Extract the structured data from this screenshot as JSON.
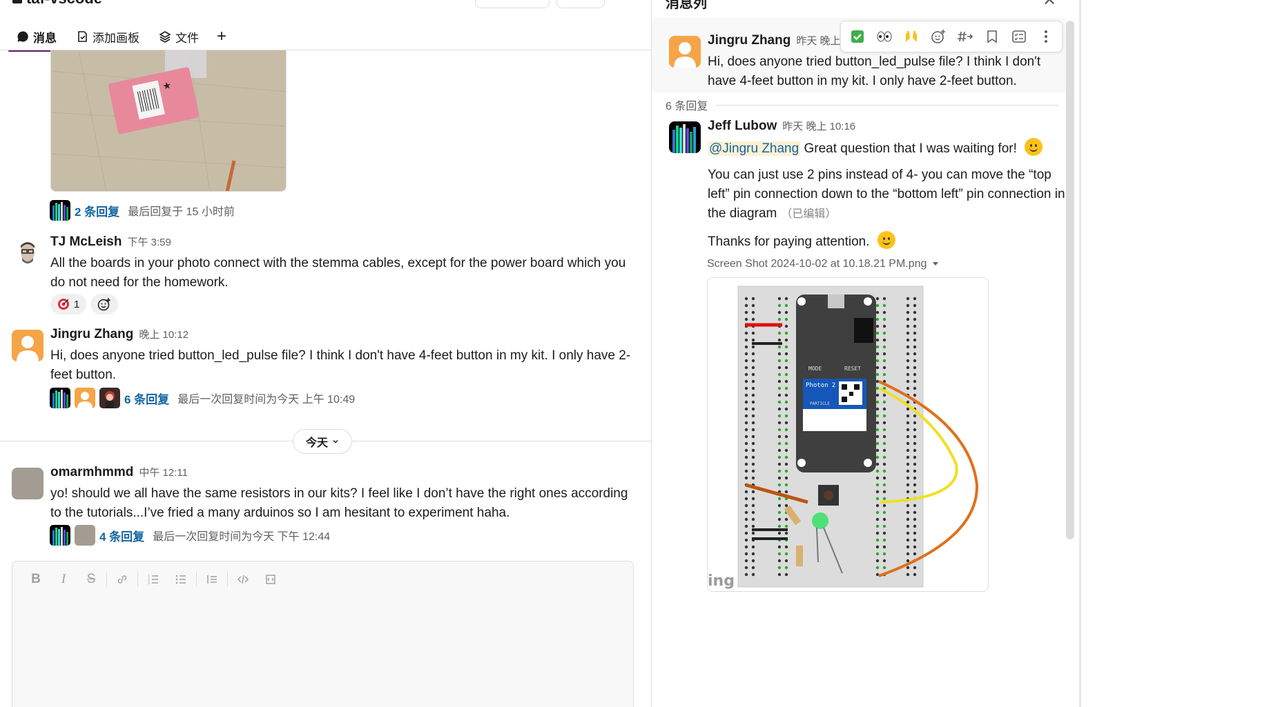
{
  "channel": {
    "title": "taf-vscode"
  },
  "tabs": [
    {
      "label": "消息",
      "icon": "message-icon",
      "active": true
    },
    {
      "label": "添加画板",
      "icon": "canvas-icon",
      "active": false
    },
    {
      "label": "文件",
      "icon": "files-icon",
      "active": false
    }
  ],
  "messages": {
    "first_thread": {
      "count_label": "2 条回复",
      "meta": "最后回复于 15 小时前"
    },
    "tj": {
      "name": "TJ McLeish",
      "time": "下午 3:59",
      "body": "All the boards in your photo connect with the stemma cables, except for the power board which you do not need for the homework.",
      "reaction_count": "1"
    },
    "jingru": {
      "name": "Jingru Zhang",
      "time": "晚上 10:12",
      "body": "Hi, does anyone tried button_led_pulse file? I think I don't have 4-feet button in my kit. I only have 2-feet button.",
      "thread": {
        "count_label": "6 条回复",
        "meta": "最后一次回复时间为今天 上午 10:49"
      }
    },
    "day_divider": "今天",
    "omar": {
      "name": "omarmhmmd",
      "time": "中午 12:11",
      "body": "yo! should we all have the same resistors in our kits? I feel like I don’t have the right ones according to the tutorials...I’ve fried a many arduinos so I am hesitant to experiment haha.",
      "thread": {
        "count_label": "4 条回复",
        "meta": "最后一次回复时间为今天 下午 12:44"
      }
    }
  },
  "composer": {
    "tools": [
      "B",
      "I",
      "S",
      "link-icon",
      "ordered-list-icon",
      "bullet-list-icon",
      "blockquote-icon",
      "code-icon",
      "code-block-icon"
    ]
  },
  "thread_panel": {
    "title": "消息列",
    "root": {
      "name": "Jingru Zhang",
      "time": "昨天 晚上 1",
      "body": "Hi, does anyone tried button_led_pulse file? I think I don't have 4-feet button in my kit. I only have 2-feet button."
    },
    "replies_label": "6 条回复",
    "reply": {
      "name": "Jeff Lubow",
      "time": "昨天 晚上 10:16",
      "mention": "@Jingru Zhang",
      "line1": "Great question that I was waiting for!",
      "para2": "You can just use 2 pins instead of 4- you can move the “top left” pin connection down to the “bottom left” pin connection in the diagram",
      "edited": "（已编辑）",
      "para3": "Thanks for paying attention.",
      "file_name": "Screen Shot 2024-10-02 at 10.18.21 PM.png"
    },
    "diagram": {
      "board_label": "Photon 2",
      "mode": "MODE",
      "reset": "RESET",
      "particle": "PARTICLE",
      "watermark": "ing"
    }
  },
  "colors": {
    "accent": "#611f69",
    "link": "#1264a3",
    "mention_bg": "#fdf1d3"
  }
}
